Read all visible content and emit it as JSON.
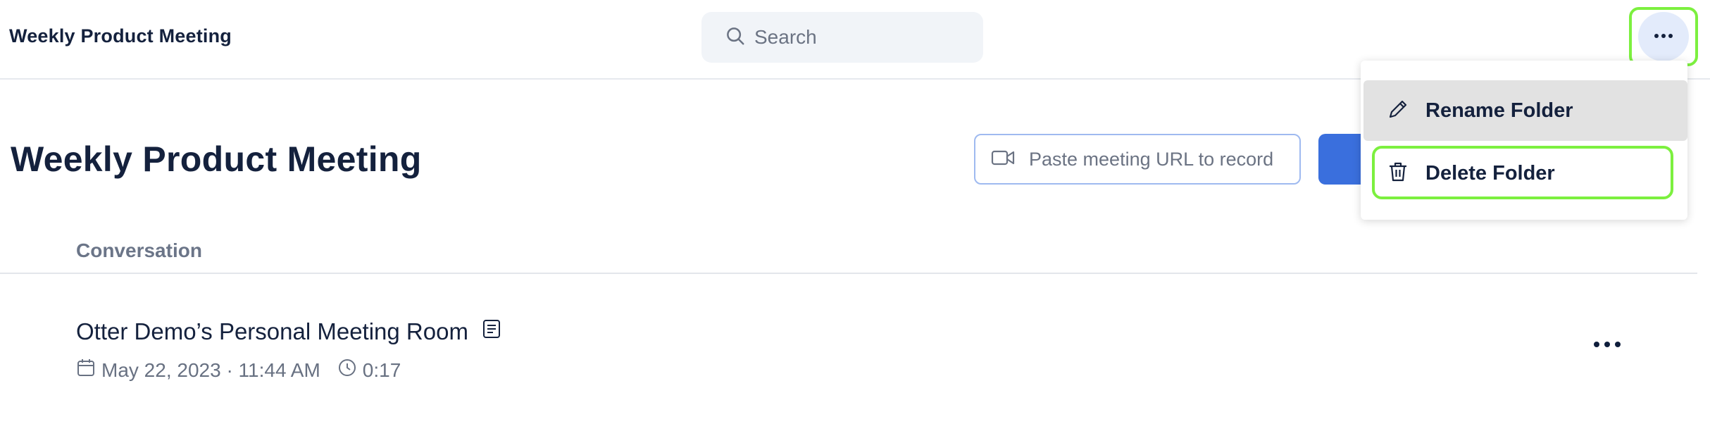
{
  "header": {
    "title": "Weekly Product Meeting",
    "search_placeholder": "Search",
    "more_icon": "ellipsis-icon"
  },
  "main": {
    "title": "Weekly Product Meeting",
    "url_input_placeholder": "Paste meeting URL to record",
    "url_input_icon": "video-camera-icon",
    "column_header": "Conversation",
    "conversations": [
      {
        "title": "Otter Demo’s Personal Meeting Room",
        "date": "May 22, 2023 · 11:44 AM",
        "duration": "0:17"
      }
    ]
  },
  "dropdown": {
    "items": [
      {
        "label": "Rename Folder",
        "icon": "pencil-icon"
      },
      {
        "label": "Delete Folder",
        "icon": "trash-icon"
      }
    ]
  },
  "colors": {
    "accent_blue": "#3a6fdd",
    "highlight_green": "#7cf03f",
    "text_dark": "#14213d",
    "text_muted": "#6b7383"
  }
}
